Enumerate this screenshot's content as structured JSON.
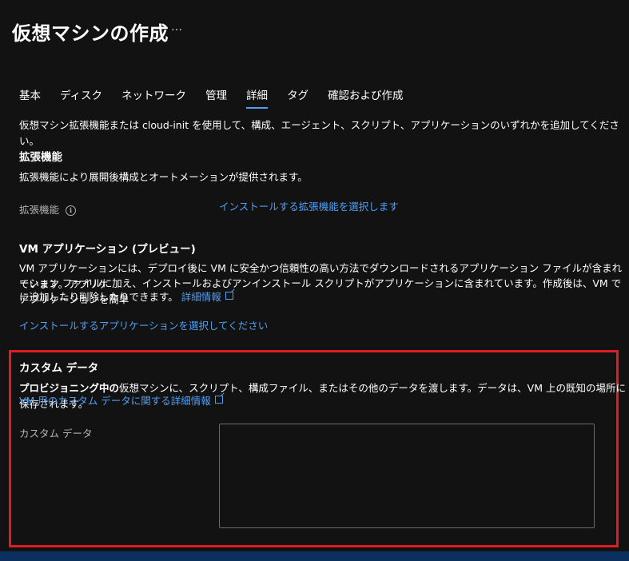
{
  "header": {
    "title": "仮想マシンの作成",
    "more_label": "…"
  },
  "tabs": [
    {
      "label": "基本",
      "active": false
    },
    {
      "label": "ディスク",
      "active": false
    },
    {
      "label": "ネットワーク",
      "active": false
    },
    {
      "label": "管理",
      "active": false
    },
    {
      "label": "詳細",
      "active": true
    },
    {
      "label": "タグ",
      "active": false
    },
    {
      "label": "確認および作成",
      "active": false
    }
  ],
  "intro_text": "仮想マシン拡張機能または cloud-init を使用して、構成、エージェント、スクリプト、アプリケーションのいずれかを追加してください。",
  "extensions": {
    "heading": "拡張機能",
    "description": "拡張機能により展開後構成とオートメーションが提供されます。",
    "field_label": "拡張機能",
    "select_link": "インストールする拡張機能を選択します"
  },
  "vm_apps": {
    "heading": "VM アプリケーション (プレビュー)",
    "description_line1": "VM アプリケーションには、デプロイ後に VM に安全かつ信頼性の高い方法でダウンロードされるアプリケーション ファイルが含まれています。アプリケ",
    "description_line2": "ーション ファイルに加え、インストールおよびアンインストール スクリプトがアプリケーションに含まれています。作成後は、VM でアプリケーションを簡単",
    "description_line3": "に追加したり削除したりできます。",
    "learn_more": "詳細情報",
    "select_link": "インストールするアプリケーションを選択してください"
  },
  "custom_data": {
    "heading": "カスタム データ",
    "description_bold": "プロビジョニング中の",
    "description_rest": "仮想マシンに、スクリプト、構成ファイル、またはその他のデータを渡します。データは、VM 上の既知の場所に保存されます。",
    "learn_more": "VM 用のカスタム データに関する詳細情報",
    "field_label": "カスタム データ",
    "value": ""
  },
  "colors": {
    "background": "#121212",
    "link": "#4f9ff5",
    "highlight_border": "#e21b23",
    "muted_text": "#b3b3b3"
  },
  "icons": {
    "info": "info-icon",
    "external_link": "external-link-icon",
    "more": "ellipsis-icon"
  }
}
